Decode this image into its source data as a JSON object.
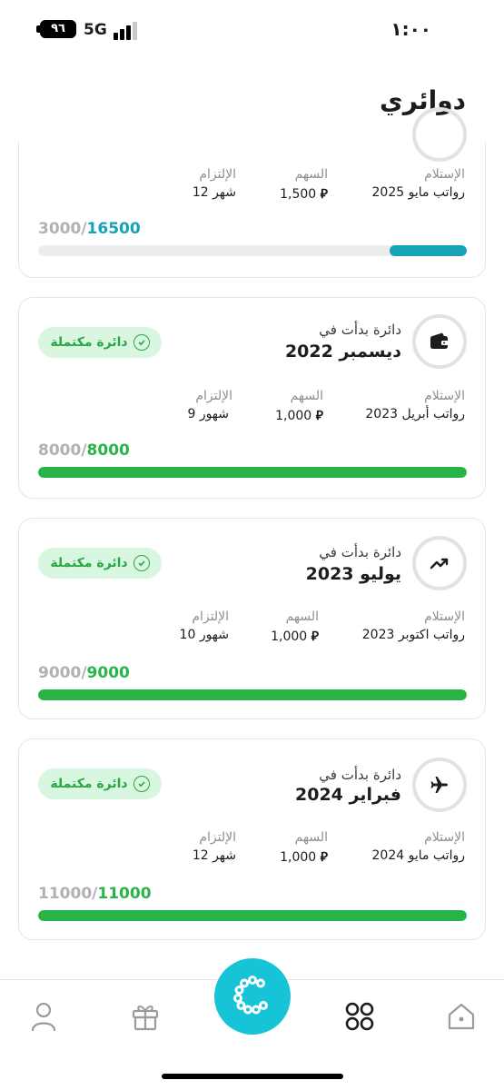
{
  "status_bar": {
    "battery": "٩٦",
    "network": "5G",
    "time": "١:٠٠"
  },
  "page": {
    "title": "دوائري"
  },
  "labels": {
    "receive": "الإستلام",
    "share": "السهم",
    "commitment": "الإلتزام",
    "started_in": "دائرة بدأت في",
    "currency": "⃁",
    "completed_badge": "دائرة مكتملة"
  },
  "circles": [
    {
      "icon": "partial-icon",
      "receive": "رواتب مايو 2025",
      "share": "1,500",
      "commitment": "12 شهر",
      "paid": "3000",
      "total": "16500",
      "progress": 0.18,
      "color": "#17a2b8"
    },
    {
      "icon": "wallet-icon",
      "started": "ديسمبر 2022",
      "completed": true,
      "receive": "رواتب أبريل 2023",
      "share": "1,000",
      "commitment": "9 شهور",
      "paid": "8000",
      "total": "8000",
      "progress": 1.0,
      "color": "#28b446"
    },
    {
      "icon": "trending-up-icon",
      "started": "يوليو 2023",
      "completed": true,
      "receive": "رواتب اكتوبر 2023",
      "share": "1,000",
      "commitment": "10 شهور",
      "paid": "9000",
      "total": "9000",
      "progress": 1.0,
      "color": "#28b446"
    },
    {
      "icon": "airplane-icon",
      "started": "فبراير 2024",
      "completed": true,
      "receive": "رواتب مايو 2024",
      "share": "1,000",
      "commitment": "12 شهر",
      "paid": "11000",
      "total": "11000",
      "progress": 1.0,
      "color": "#28b446"
    }
  ],
  "nav": {
    "items": [
      "home-icon",
      "circles-icon",
      "fab-icon",
      "gift-icon",
      "profile-icon"
    ]
  },
  "colors": {
    "accent": "#17c3d6",
    "teal": "#17a2b8",
    "green": "#28b446",
    "badge_bg": "#d9f6e1"
  }
}
